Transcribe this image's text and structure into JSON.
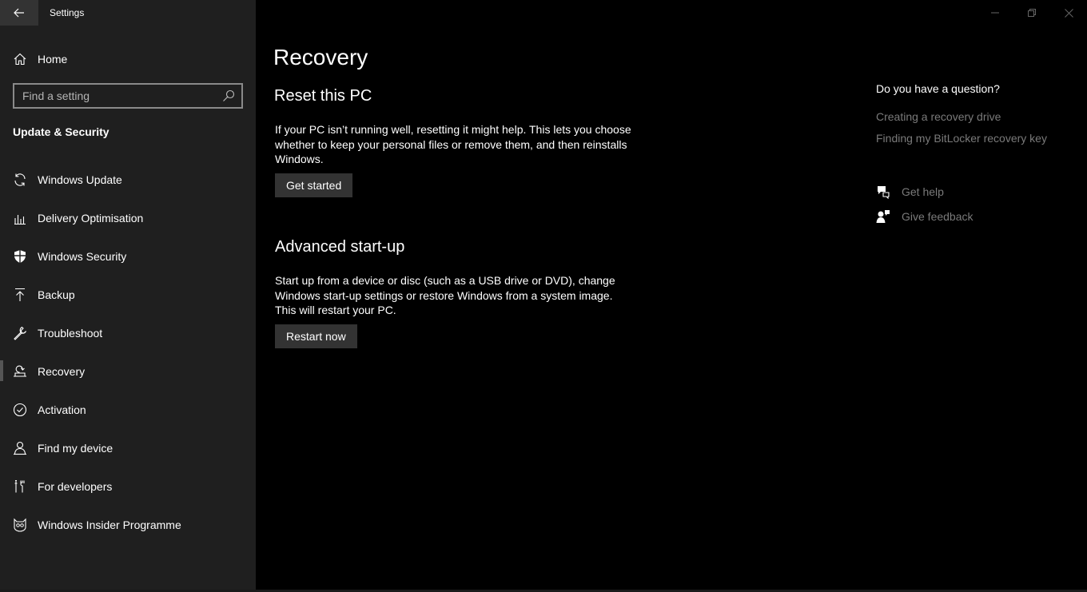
{
  "window": {
    "title": "Settings",
    "controls": [
      "minimize-icon",
      "restore-icon",
      "close-icon"
    ]
  },
  "sidebar": {
    "home_label": "Home",
    "search_placeholder": "Find a setting",
    "section_heading": "Update & Security",
    "selected": "Recovery",
    "items": [
      {
        "label": "Windows Update",
        "icon": "sync-icon"
      },
      {
        "label": "Delivery Optimisation",
        "icon": "delivery-optimisation-icon"
      },
      {
        "label": "Windows Security",
        "icon": "shield-icon"
      },
      {
        "label": "Backup",
        "icon": "upload-arrow-icon"
      },
      {
        "label": "Troubleshoot",
        "icon": "wrench-icon"
      },
      {
        "label": "Recovery",
        "icon": "recovery-icon"
      },
      {
        "label": "Activation",
        "icon": "check-circle-icon"
      },
      {
        "label": "Find my device",
        "icon": "person-location-icon"
      },
      {
        "label": "For developers",
        "icon": "developer-tools-icon"
      },
      {
        "label": "Windows Insider Programme",
        "icon": "insider-cat-icon"
      }
    ]
  },
  "main": {
    "title": "Recovery",
    "reset": {
      "heading": "Reset this PC",
      "description": "If your PC isn’t running well, resetting it might help. This lets you choose whether to keep your personal files or remove them, and then reinstalls Windows.",
      "button": "Get started"
    },
    "advanced": {
      "heading": "Advanced start-up",
      "description": "Start up from a device or disc (such as a USB drive or DVD), change Windows start-up settings or restore Windows from a system image. This will restart your PC.",
      "button": "Restart now"
    }
  },
  "related": {
    "question": "Do you have a question?",
    "links": [
      "Creating a recovery drive",
      "Finding my BitLocker recovery key"
    ],
    "get_help": "Get help",
    "give_feedback": "Give feedback"
  },
  "colors": {
    "sidebar_bg": "#1f1f1f",
    "main_bg": "#000000",
    "button_bg": "#333333",
    "link_gray": "#7a7a7a"
  }
}
